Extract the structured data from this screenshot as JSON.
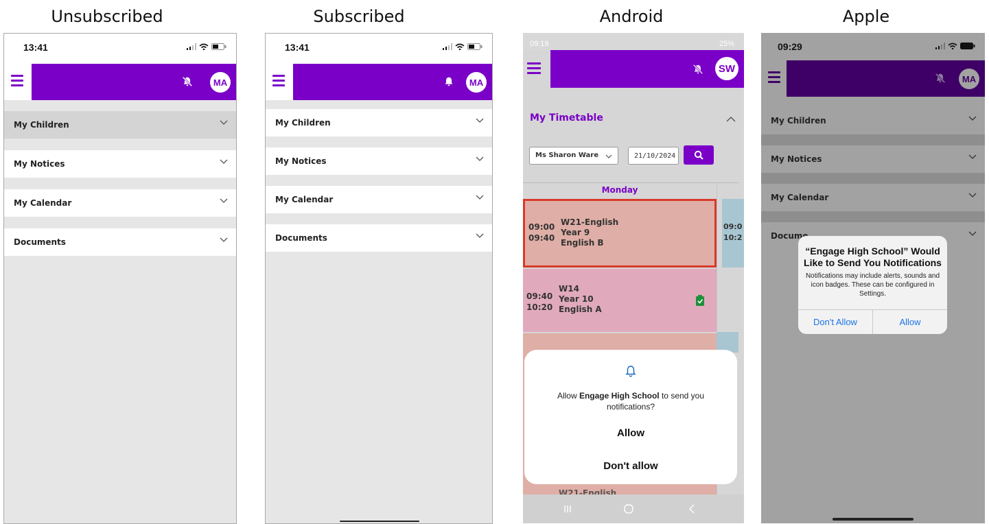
{
  "captions": [
    "Unsubscribed",
    "Subscribed",
    "Android",
    "Apple"
  ],
  "unsubscribed": {
    "time": "13:41",
    "avatar": "MA",
    "sections": [
      "My Children",
      "My Notices",
      "My Calendar",
      "Documents"
    ]
  },
  "subscribed": {
    "time": "13:41",
    "avatar": "MA",
    "sections": [
      "My Children",
      "My Notices",
      "My Calendar",
      "Documents"
    ]
  },
  "android": {
    "time": "09:19",
    "battery": "25%",
    "avatar": "SW",
    "timetable_title": "My Timetable",
    "teacher": "Ms Sharon Ware",
    "date": "21/10/2024",
    "day": "Monday",
    "lessons": [
      {
        "start": "09:00",
        "end": "09:40",
        "code": "W21-English",
        "year": "Year 9",
        "group": "English B"
      },
      {
        "start": "09:40",
        "end": "10:20",
        "code": "W14",
        "year": "Year 10",
        "group": "English A"
      }
    ],
    "side_times": [
      "09:0",
      "10:2"
    ],
    "peek_text": "W21-English",
    "prompt_prefix": "Allow ",
    "prompt_app": "Engage High School",
    "prompt_suffix": " to send you notifications?",
    "allow": "Allow",
    "dont_allow": "Don't allow"
  },
  "apple": {
    "time": "09:29",
    "avatar": "MA",
    "sections": [
      "My Children",
      "My Notices",
      "My Calendar",
      "Docume"
    ],
    "alert_title": "“Engage High School” Would Like to Send You Notifications",
    "alert_message": "Notifications may include alerts, sounds and icon badges. These can be configured in Settings.",
    "dont_allow": "Don't Allow",
    "allow": "Allow"
  },
  "colors": {
    "brand": "#7a00c8",
    "ios_blue": "#1a73e8",
    "lesson_red": "#e0a9a4",
    "lesson_pink": "#e2aabb"
  }
}
